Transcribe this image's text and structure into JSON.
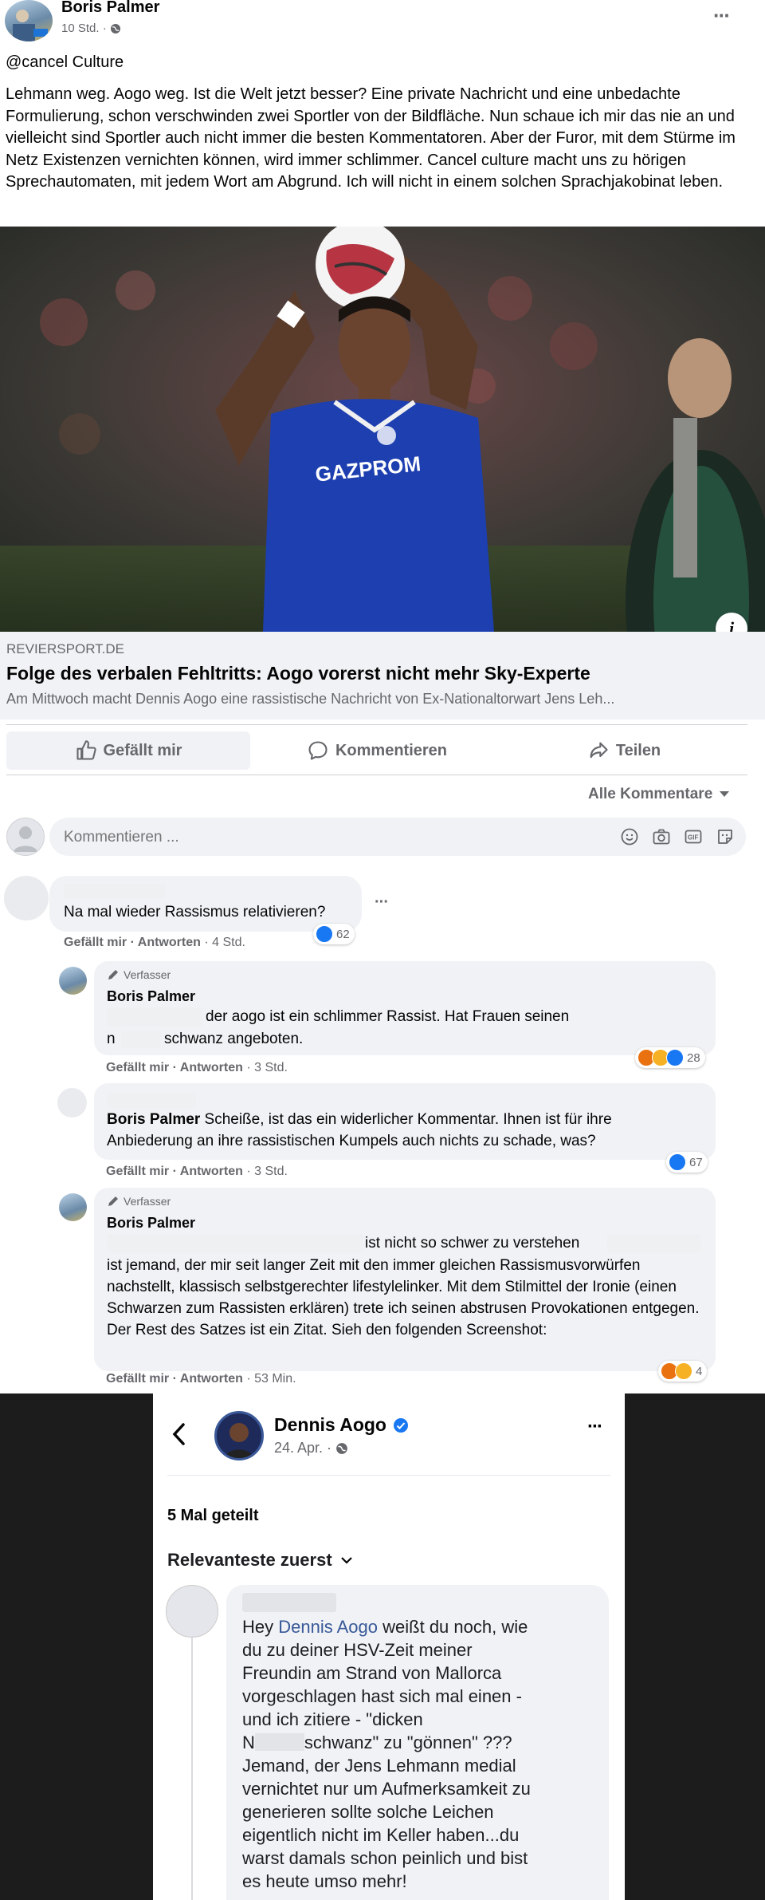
{
  "post": {
    "author": "Boris Palmer",
    "time": "10 Std. ·",
    "headline": "@cancel Culture",
    "body": "Lehmann weg. Aogo weg. Ist die Welt jetzt besser? Eine private Nachricht und eine unbedachte Formulierung, schon verschwinden zwei Sportler von der Bildfläche. Nun schaue ich mir das nie an und vielleicht sind Sportler auch nicht immer die besten Kommentatoren. Aber der Furor, mit dem Stürme im Netz Existenzen vernichten können, wird immer schlimmer. Cancel culture macht uns zu hörigen Sprechautomaten, mit jedem Wort am Abgrund. Ich will nicht in einem solchen Sprachjakobinat leben.",
    "more_label": "···",
    "image_jersey_text": "GAZPROM"
  },
  "link": {
    "domain": "REVIERSPORT.DE",
    "title": "Folge des verbalen Fehltritts: Aogo vorerst nicht mehr Sky-Experte",
    "desc": "Am Mittwoch macht Dennis Aogo eine rassistische Nachricht von Ex-Nationaltorwart Jens Leh...",
    "info_label": "i"
  },
  "actions": {
    "like": "Gefällt mir",
    "comment": "Kommentieren",
    "share": "Teilen"
  },
  "filter": {
    "label": "Alle Kommentare"
  },
  "composer": {
    "placeholder": "Kommentieren ..."
  },
  "comments": [
    {
      "text": "Na mal wieder Rassismus relativieren?",
      "like_label": "Gefällt mir",
      "reply_label": "Antworten",
      "time": "· 4 Std.",
      "reactions": "62",
      "more": "···"
    },
    {
      "badge": "Verfasser",
      "author": "Boris Palmer",
      "line1": "der aogo ist ein schlimmer Rassist. Hat Frauen seinen",
      "line2_a": "n",
      "line2_b": "schwanz angeboten.",
      "like_label": "Gefällt mir",
      "reply_label": "Antworten",
      "time": "· 3 Std.",
      "reactions": "28"
    },
    {
      "author": "Boris Palmer",
      "text": "Scheiße, ist das ein widerlicher Kommentar. Ihnen ist für ihre Anbiederung an ihre rassistischen Kumpels auch nichts zu schade, was?",
      "like_label": "Gefällt mir",
      "reply_label": "Antworten",
      "time": "· 3 Std.",
      "reactions": "67"
    },
    {
      "badge": "Verfasser",
      "author": "Boris Palmer",
      "line1": "ist nicht so schwer zu verstehen",
      "rest": "ist jemand, der mir seit langer Zeit mit den immer gleichen Rassismusvorwürfen nachstellt, klassisch selbstgerechter lifestylelinker. Mit dem Stilmittel der Ironie (einen Schwarzen zum Rassisten erklären) trete ich seinen abstrusen Provokationen entgegen. Der Rest des Satzes ist ein Zitat. Sieh den folgenden Screenshot:",
      "like_label": "Gefällt mir",
      "reply_label": "Antworten",
      "time": "· 53 Min.",
      "reactions": "4"
    }
  ],
  "screenshot": {
    "name": "Dennis Aogo",
    "date": "24. Apr. ·",
    "shares": "5 Mal geteilt",
    "sort": "Relevanteste zuerst",
    "more": "···",
    "msg_hey": "Hey",
    "msg_name": "Dennis Aogo",
    "msg_l1": "weißt du noch, wie",
    "msg_l2": "du zu deiner HSV-Zeit meiner",
    "msg_l3": "Freundin am Strand von Mallorca",
    "msg_l4": "vorgeschlagen hast sich mal einen -",
    "msg_l5": "und ich zitiere - \"dicken",
    "msg_l6a": "N",
    "msg_l6b": "schwanz\" zu \"gönnen\" ???",
    "msg_l7": "Jemand, der Jens Lehmann medial",
    "msg_l8": "vernichtet nur um Aufmerksamkeit zu",
    "msg_l9": "generieren sollte solche Leichen",
    "msg_l10": "eigentlich nicht im Keller haben...du",
    "msg_l11": "warst damals schon peinlich und bist",
    "msg_l12": "es heute umso mehr!"
  },
  "colors": {
    "fb_blue": "#1877f2",
    "text": "#050505",
    "secondary": "#65676b",
    "bubble": "#f0f2f5",
    "jersey": "#1d3fb0"
  }
}
